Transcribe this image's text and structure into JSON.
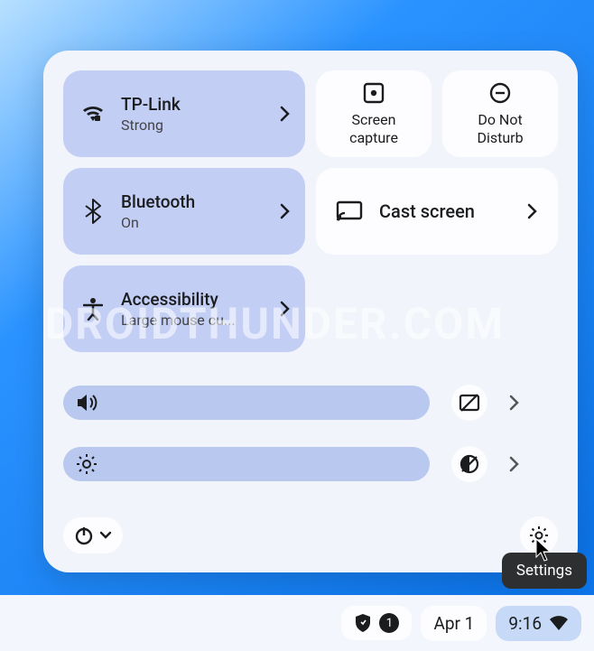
{
  "tiles": {
    "wifi": {
      "title": "TP-Link",
      "sub": "Strong"
    },
    "bt": {
      "title": "Bluetooth",
      "sub": "On"
    },
    "a11y": {
      "title": "Accessibility",
      "sub": "Large mouse cu..."
    },
    "capture": {
      "label": "Screen capture"
    },
    "dnd": {
      "label": "Do Not Disturb"
    },
    "cast": {
      "title": "Cast screen"
    }
  },
  "tooltip": "Settings",
  "shelf": {
    "date": "Apr 1",
    "time": "9:16",
    "badge": "1"
  },
  "watermark": "DROIDTHUNDER.COM"
}
